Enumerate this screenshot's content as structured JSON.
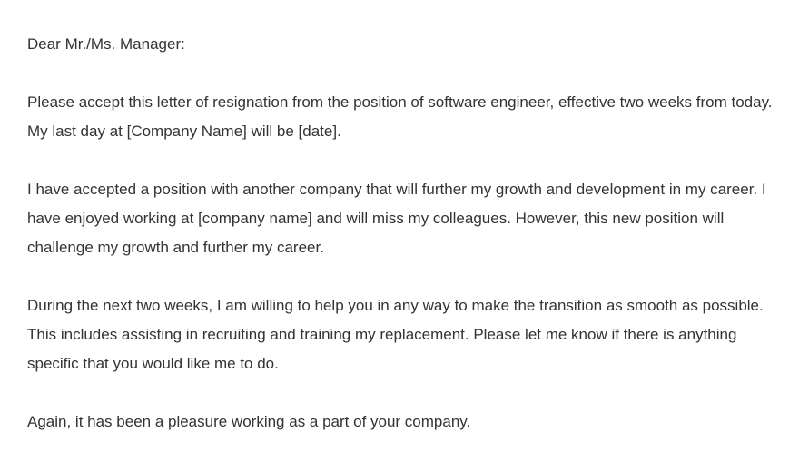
{
  "letter": {
    "salutation": "Dear Mr./Ms. Manager:",
    "paragraphs": [
      "Please accept this letter of resignation from the position of software engineer, effective two weeks from today. My last day at [Company Name] will be [date].",
      "I have accepted a position with another company that will further my growth and development in my career. I have enjoyed working at [company name] and will miss my colleagues. However, this new position will challenge my growth and further my career.",
      "During the next two weeks, I am willing to help you in any way to make the transition as smooth as possible. This includes assisting in recruiting and training my replacement. Please let me know if there is anything specific that you would like me to do.",
      "Again, it has been a pleasure working as a part of your company."
    ]
  }
}
